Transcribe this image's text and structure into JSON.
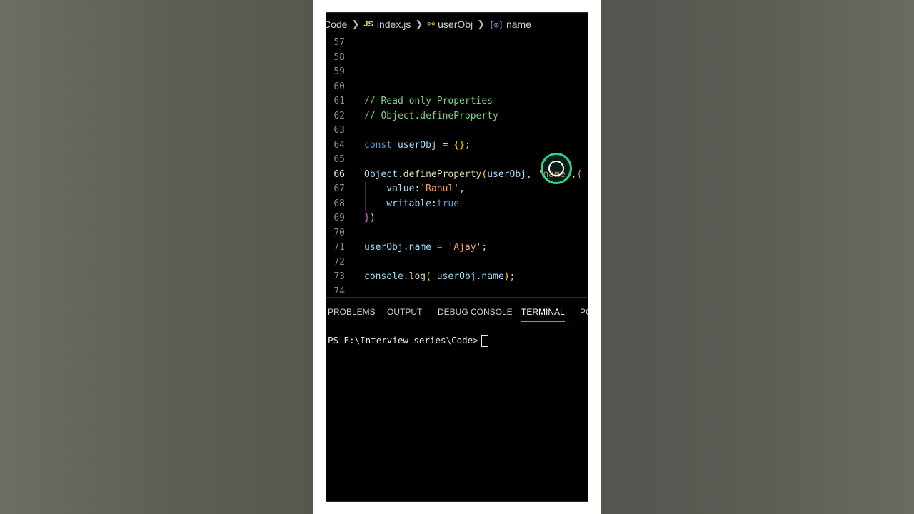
{
  "breadcrumb": {
    "folder": "Code",
    "file_icon": "JS",
    "file": "index.js",
    "object": "userObj",
    "property": "name"
  },
  "editor": {
    "lines": [
      {
        "n": "57"
      },
      {
        "n": "58"
      },
      {
        "n": "59"
      },
      {
        "n": "60"
      },
      {
        "n": "61",
        "tokens": [
          {
            "t": "// Read only Properties",
            "c": "c-com"
          }
        ]
      },
      {
        "n": "62",
        "tokens": [
          {
            "t": "// Object.defineProperty",
            "c": "c-com"
          }
        ]
      },
      {
        "n": "63"
      },
      {
        "n": "64",
        "tokens": [
          {
            "t": "const ",
            "c": "c-kwblue"
          },
          {
            "t": "userObj",
            "c": "c-var"
          },
          {
            "t": " = ",
            "c": "c-txt"
          },
          {
            "t": "{}",
            "c": "c-br1"
          },
          {
            "t": ";",
            "c": "c-txt"
          }
        ]
      },
      {
        "n": "65"
      },
      {
        "n": "66",
        "active": true,
        "tokens": [
          {
            "t": "Object",
            "c": "c-var"
          },
          {
            "t": ".",
            "c": "c-txt"
          },
          {
            "t": "defineProperty",
            "c": "c-fn"
          },
          {
            "t": "(",
            "c": "c-br1"
          },
          {
            "t": "userObj",
            "c": "c-var"
          },
          {
            "t": ", ",
            "c": "c-txt"
          },
          {
            "t": "'name'",
            "c": "c-str"
          },
          {
            "t": ",",
            "c": "c-txt"
          },
          {
            "t": "{",
            "c": "c-br2"
          }
        ]
      },
      {
        "n": "67",
        "tokens": [
          {
            "t": "    value",
            "c": "c-var"
          },
          {
            "t": ":",
            "c": "c-txt"
          },
          {
            "t": "'Rahul'",
            "c": "c-str"
          },
          {
            "t": ",",
            "c": "c-txt"
          }
        ]
      },
      {
        "n": "68",
        "tokens": [
          {
            "t": "    writable",
            "c": "c-var"
          },
          {
            "t": ":",
            "c": "c-txt"
          },
          {
            "t": "true",
            "c": "c-kwblue"
          }
        ]
      },
      {
        "n": "69",
        "tokens": [
          {
            "t": "}",
            "c": "c-br2"
          },
          {
            "t": ")",
            "c": "c-br1"
          }
        ]
      },
      {
        "n": "70"
      },
      {
        "n": "71",
        "tokens": [
          {
            "t": "userObj",
            "c": "c-var"
          },
          {
            "t": ".",
            "c": "c-txt"
          },
          {
            "t": "name",
            "c": "c-var"
          },
          {
            "t": " = ",
            "c": "c-txt"
          },
          {
            "t": "'Ajay'",
            "c": "c-str"
          },
          {
            "t": ";",
            "c": "c-txt"
          }
        ]
      },
      {
        "n": "72"
      },
      {
        "n": "73",
        "tokens": [
          {
            "t": "console",
            "c": "c-var"
          },
          {
            "t": ".",
            "c": "c-txt"
          },
          {
            "t": "log",
            "c": "c-fn"
          },
          {
            "t": "( ",
            "c": "c-br1"
          },
          {
            "t": "userObj",
            "c": "c-var"
          },
          {
            "t": ".",
            "c": "c-txt"
          },
          {
            "t": "name",
            "c": "c-var"
          },
          {
            "t": ")",
            "c": "c-br1"
          },
          {
            "t": ";",
            "c": "c-txt"
          }
        ]
      },
      {
        "n": "74"
      }
    ]
  },
  "panel": {
    "tabs": [
      {
        "label": "PROBLEMS"
      },
      {
        "label": "OUTPUT"
      },
      {
        "label": "DEBUG CONSOLE"
      },
      {
        "label": "TERMINAL",
        "active": true
      },
      {
        "label": "PO"
      }
    ],
    "terminal_prompt": "PS E:\\Interview series\\Code>"
  },
  "colors": {
    "background": "#000000",
    "comment": "#7fd37f",
    "string": "#f2a26e",
    "active_tab_underline": "#4aa3ff",
    "cursor_ring": "#2fd08a"
  }
}
